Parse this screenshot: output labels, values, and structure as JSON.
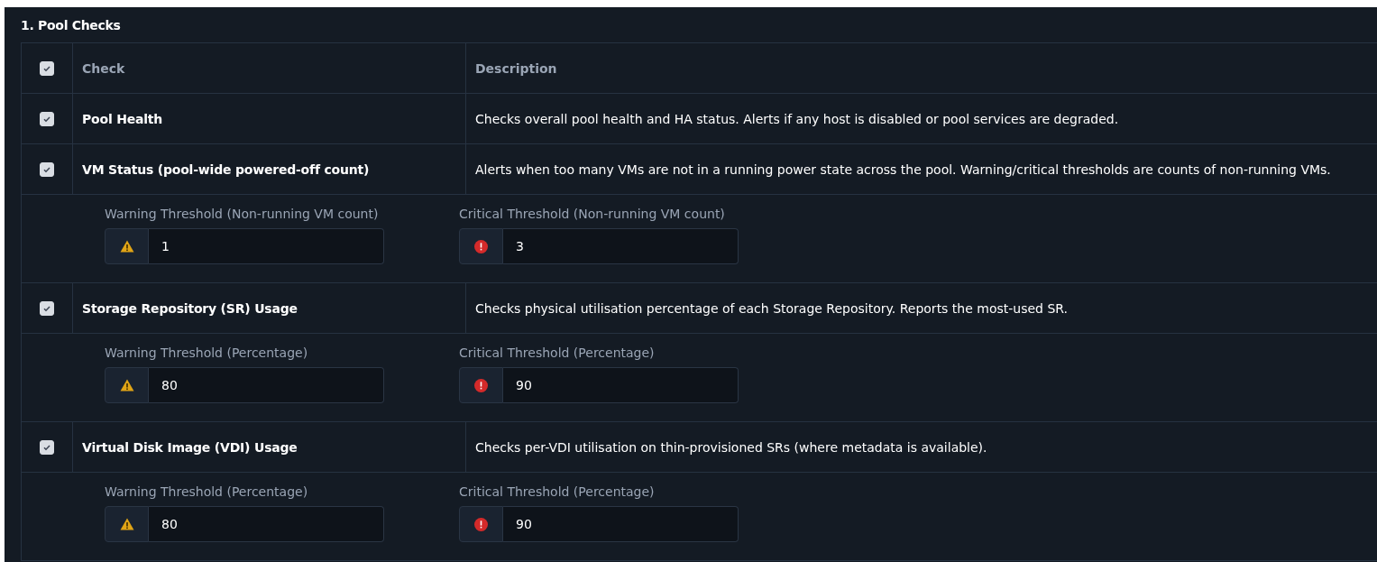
{
  "section_title": "1. Pool Checks",
  "table": {
    "select_all": {
      "checked": true
    },
    "columns": [
      "Check",
      "Description"
    ],
    "rows": [
      {
        "name": "Pool Health",
        "description": "Checks overall pool health and HA status. Alerts if any host is disabled or pool services are degraded.",
        "checked": true,
        "thresholds": []
      },
      {
        "name": "VM Status (pool-wide powered-off count)",
        "description": "Alerts when too many VMs are not in a running power state across the pool. Warning/critical thresholds are counts of non-running VMs.",
        "checked": true,
        "thresholds": [
          {
            "kind": "warning",
            "label": "Warning Threshold (Non-running VM count)",
            "value": "1"
          },
          {
            "kind": "critical",
            "label": "Critical Threshold (Non-running VM count)",
            "value": "3"
          }
        ]
      },
      {
        "name": "Storage Repository (SR) Usage",
        "description": "Checks physical utilisation percentage of each Storage Repository. Reports the most-used SR.",
        "checked": true,
        "thresholds": [
          {
            "kind": "warning",
            "label": "Warning Threshold (Percentage)",
            "value": "80"
          },
          {
            "kind": "critical",
            "label": "Critical Threshold (Percentage)",
            "value": "90"
          }
        ]
      },
      {
        "name": "Virtual Disk Image (VDI) Usage",
        "description": "Checks per-VDI utilisation on thin-provisioned SRs (where metadata is available).",
        "checked": true,
        "thresholds": [
          {
            "kind": "warning",
            "label": "Warning Threshold (Percentage)",
            "value": "80"
          },
          {
            "kind": "critical",
            "label": "Critical Threshold (Percentage)",
            "value": "90"
          }
        ]
      }
    ]
  }
}
